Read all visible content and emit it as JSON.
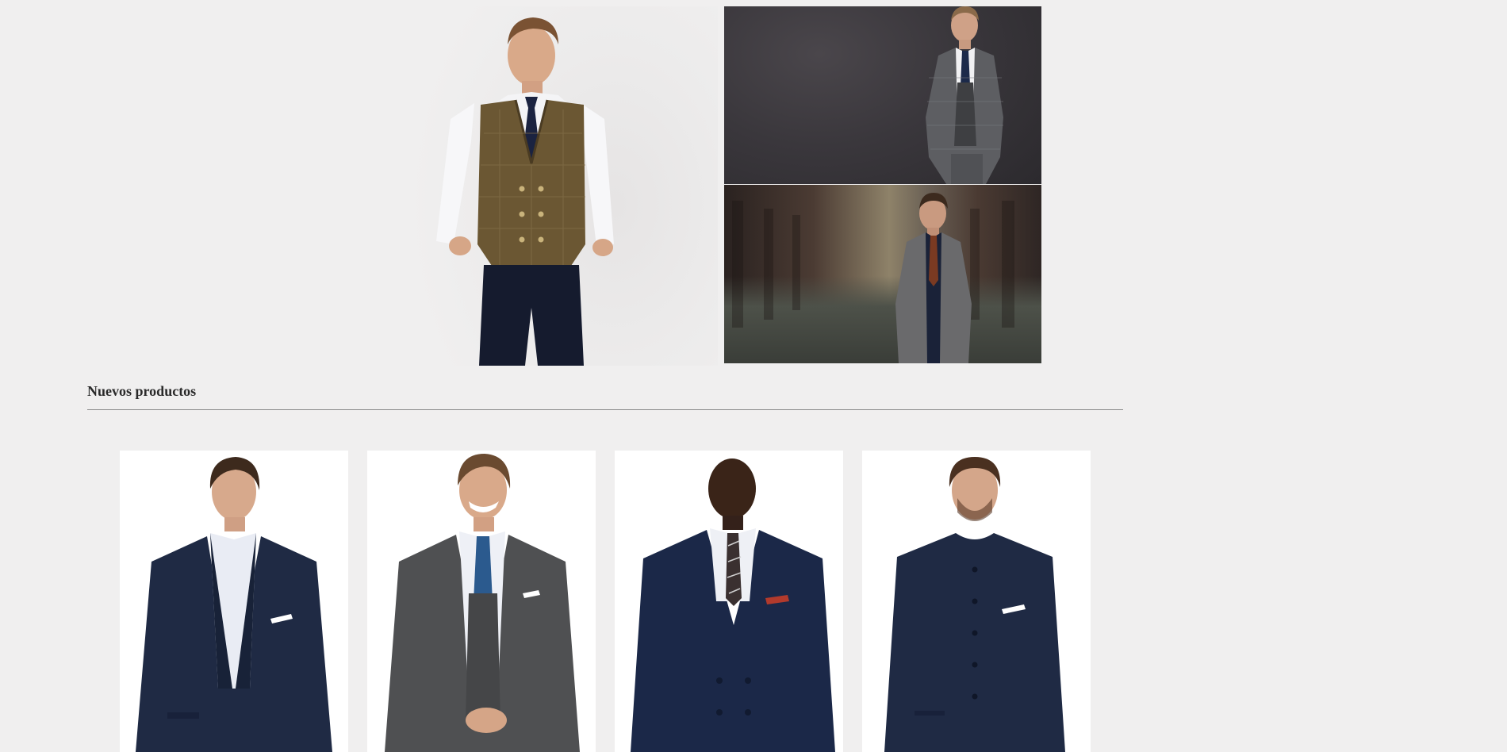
{
  "hero": {
    "main": {
      "image": "man-in-brown-check-waistcoat-photo"
    },
    "side_top": {
      "image": "man-in-grey-three-piece-suit-photo"
    },
    "side_bottom": {
      "image": "man-in-grey-overcoat-street-photo"
    }
  },
  "new_products": {
    "title": "Nuevos productos",
    "items": [
      {
        "image": "navy-two-button-suit-photo"
      },
      {
        "image": "grey-three-piece-suit-blue-tie-photo"
      },
      {
        "image": "navy-double-breasted-suit-photo"
      },
      {
        "image": "navy-mandarin-collar-suit-photo"
      }
    ]
  },
  "colors": {
    "page_background": "#f0efef",
    "navy_suit": "#1f2a44",
    "grey_suit": "#4f5052",
    "brown_vest": "#6b5733"
  }
}
